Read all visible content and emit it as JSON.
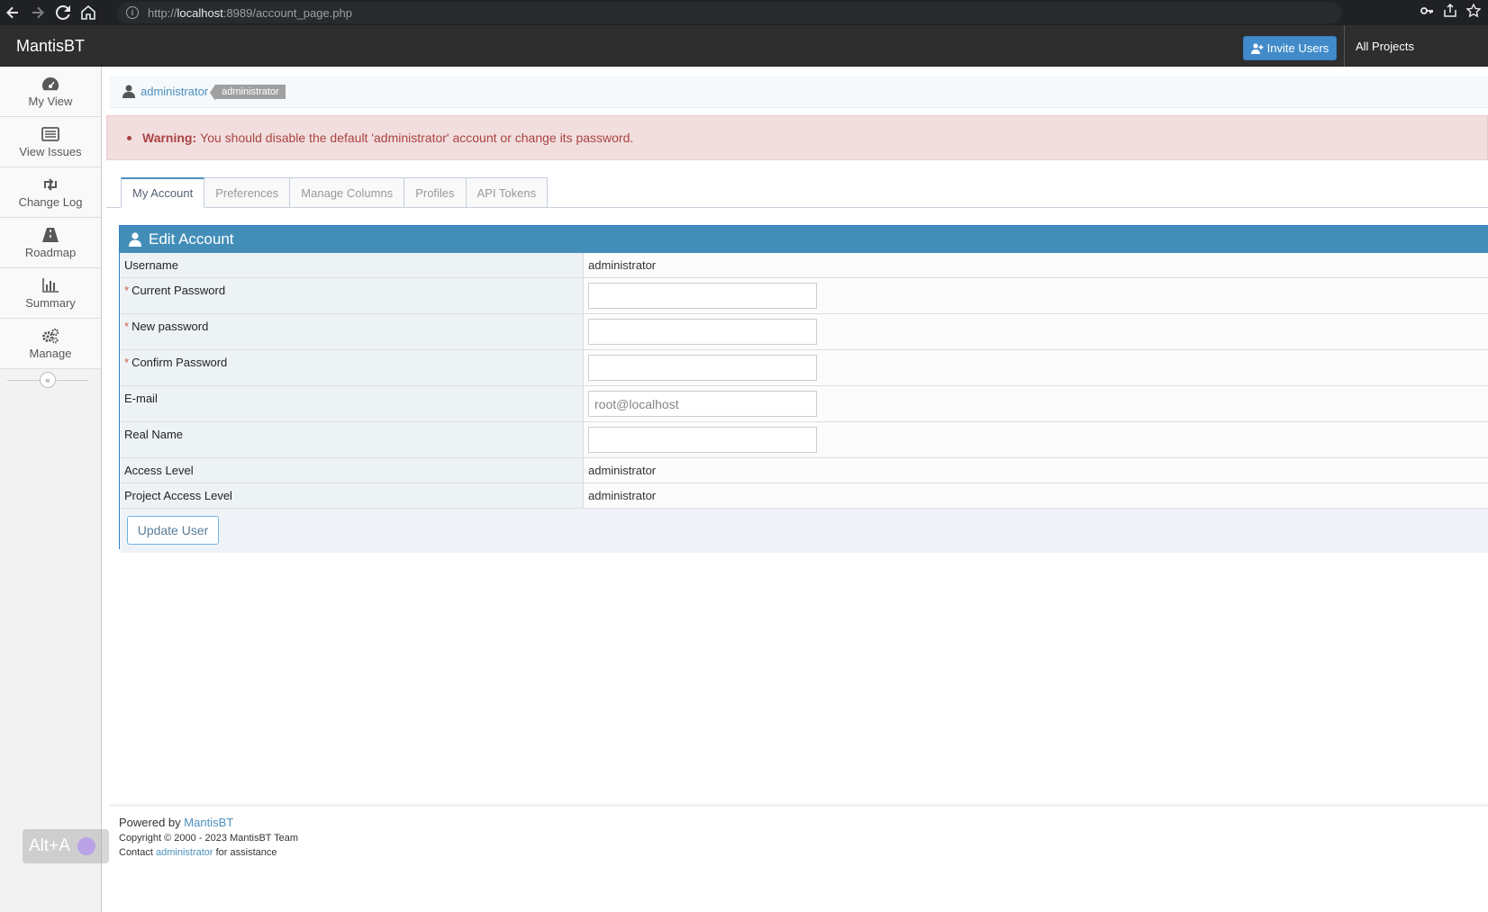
{
  "browser": {
    "url_prefix": "http://",
    "url_host": "localhost",
    "url_rest": ":8989/account_page.php"
  },
  "navbar": {
    "brand": "MantisBT",
    "invite_label": "Invite Users",
    "projects_label": "All Projects"
  },
  "sidebar": {
    "items": [
      {
        "label": "My View",
        "icon": "dashboard-icon"
      },
      {
        "label": "View Issues",
        "icon": "list-icon"
      },
      {
        "label": "Change Log",
        "icon": "retweet-icon"
      },
      {
        "label": "Roadmap",
        "icon": "road-icon"
      },
      {
        "label": "Summary",
        "icon": "bar-chart-icon"
      },
      {
        "label": "Manage",
        "icon": "gears-icon"
      }
    ],
    "collapse_glyph": "«"
  },
  "breadcrumb": {
    "user_link": "administrator",
    "badge": "administrator"
  },
  "warning": {
    "label": "Warning:",
    "message": "You should disable the default 'administrator' account or change its password."
  },
  "tabs": [
    {
      "label": "My Account",
      "active": true
    },
    {
      "label": "Preferences",
      "active": false
    },
    {
      "label": "Manage Columns",
      "active": false
    },
    {
      "label": "Profiles",
      "active": false
    },
    {
      "label": "API Tokens",
      "active": false
    }
  ],
  "form": {
    "title": "Edit Account",
    "username_label": "Username",
    "username_value": "administrator",
    "current_password_label": "Current Password",
    "new_password_label": "New password",
    "confirm_password_label": "Confirm Password",
    "email_label": "E-mail",
    "email_value": "root@localhost",
    "real_name_label": "Real Name",
    "access_level_label": "Access Level",
    "access_level_value": "administrator",
    "project_access_label": "Project Access Level",
    "project_access_value": "administrator",
    "required_marker": "*",
    "submit_label": "Update User"
  },
  "footer": {
    "powered_prefix": "Powered by",
    "powered_link": "MantisBT",
    "copyright": "Copyright © 2000 - 2023 MantisBT Team",
    "contact_prefix": "Contact",
    "contact_link": "administrator",
    "contact_suffix": "for assistance"
  },
  "overlay": {
    "label": "Alt+A"
  },
  "colors": {
    "primary": "#428bca",
    "widget_header": "#438eb9",
    "warning_bg": "#f2dede",
    "warning_text": "#a94442"
  }
}
